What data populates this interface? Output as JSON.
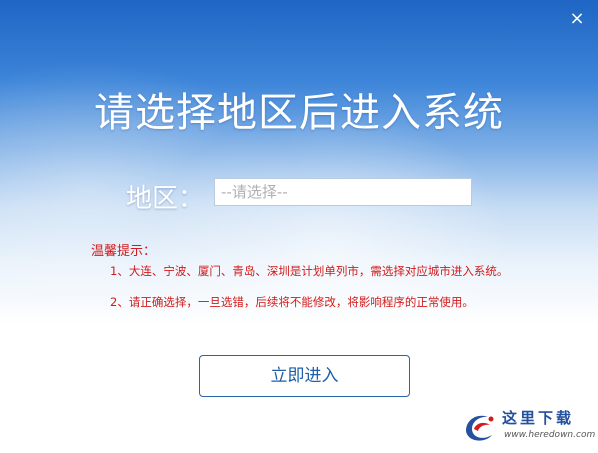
{
  "window": {
    "close_symbol": "×",
    "title": "请选择地区后进入系统"
  },
  "region": {
    "label": "地区：",
    "placeholder": "--请选择--"
  },
  "tips": {
    "title": "温馨提示：",
    "items": [
      "1、大连、宁波、厦门、青岛、深圳是计划单列市，需选择对应城市进入系统。",
      "2、请正确选择，一旦选错，后续将不能修改，将影响程序的正常使用。"
    ]
  },
  "actions": {
    "enter_label": "立即进入"
  },
  "watermark": {
    "name": "这里下载",
    "url": "www.heredown.com"
  },
  "colors": {
    "tip_red": "#d21b1b",
    "button_border": "#2c63a4",
    "button_text": "#1f5ea8",
    "header_blue": "#1f65c4"
  },
  "icons": {
    "close": "close-icon",
    "dropdown": "dropdown-select"
  }
}
